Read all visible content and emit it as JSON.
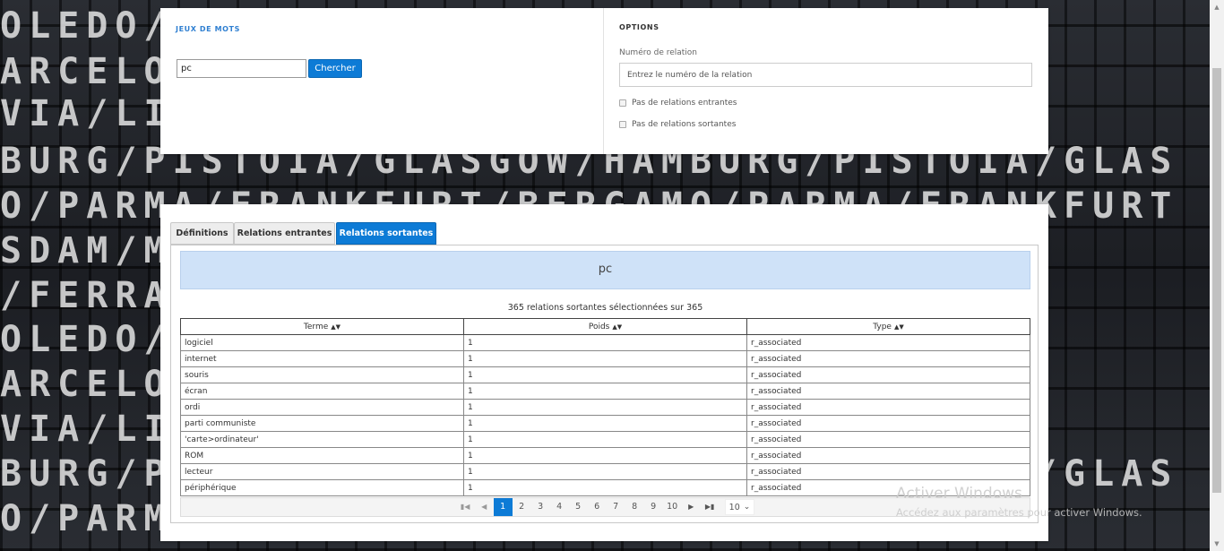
{
  "background_rows": [
    "OLEDO/BARCELONA/AMSTERDAM/K",
    "ARCELONA/MILANO/MILANO/O",
    "VIA/LISBOA/PARIS/BUDAPE",
    "BURG/PISTOIA/GLASGOW/HAMBURG/PISTOIA/GLAS",
    "O/PARMA/FRANKFURT/BERGAMO/PARMA/FRANKFURT",
    "SDAM/MADRID/BRUXELLES/DUB",
    "/FERRARA/OSLO/PARIS/RO",
    "OLEDO/BARCELONA/AMSTERDAM/K",
    "ARCELONA/MILANO/MILANO/O",
    "VIA/LISBOA/PARIS/BUDAPE",
    "BURG/PISTOIA/GLASGOW/HAMBURG/PISTOIA/GLAS",
    "O/PARMA/DUBLIN/POTSDAM/KOPFURT"
  ],
  "search": {
    "title": "JEUX DE MOTS",
    "value": "pc",
    "button_label": "Chercher"
  },
  "options": {
    "title": "OPTIONS",
    "relation_label": "Numéro de relation",
    "relation_placeholder": "Entrez le numéro de la relation",
    "no_incoming_label": "Pas de relations entrantes",
    "no_outgoing_label": "Pas de relations sortantes"
  },
  "tabs": [
    {
      "label": "Définitions"
    },
    {
      "label": "Relations entrantes"
    },
    {
      "label": "Relations sortantes"
    }
  ],
  "active_tab": "Relations sortantes",
  "result": {
    "word": "pc",
    "summary": "365 relations sortantes sélectionnées sur 365",
    "columns": [
      "Terme",
      "Poids",
      "Type"
    ],
    "rows": [
      {
        "terme": "logiciel",
        "poids": "1",
        "type": "r_associated"
      },
      {
        "terme": "internet",
        "poids": "1",
        "type": "r_associated"
      },
      {
        "terme": "souris",
        "poids": "1",
        "type": "r_associated"
      },
      {
        "terme": "écran",
        "poids": "1",
        "type": "r_associated"
      },
      {
        "terme": "ordi",
        "poids": "1",
        "type": "r_associated"
      },
      {
        "terme": "parti communiste",
        "poids": "1",
        "type": "r_associated"
      },
      {
        "terme": "'carte>ordinateur'",
        "poids": "1",
        "type": "r_associated"
      },
      {
        "terme": "ROM",
        "poids": "1",
        "type": "r_associated"
      },
      {
        "terme": "lecteur",
        "poids": "1",
        "type": "r_associated"
      },
      {
        "terme": "périphérique",
        "poids": "1",
        "type": "r_associated"
      }
    ]
  },
  "pagination": {
    "pages": [
      "1",
      "2",
      "3",
      "4",
      "5",
      "6",
      "7",
      "8",
      "9",
      "10"
    ],
    "current": "1",
    "page_size": "10"
  },
  "watermark": {
    "title": "Activer Windows",
    "subtitle": "Accédez aux paramètres pour activer Windows."
  },
  "colors": {
    "accent": "#0d7bd6",
    "banner": "#cfe2f8",
    "section_title": "#2f7fd1"
  },
  "icons": {
    "sort": "sort-icon",
    "first_page": "first-page-icon",
    "prev_page": "prev-page-icon",
    "next_page": "next-page-icon",
    "last_page": "last-page-icon",
    "page_size": "chevron-down-icon"
  }
}
